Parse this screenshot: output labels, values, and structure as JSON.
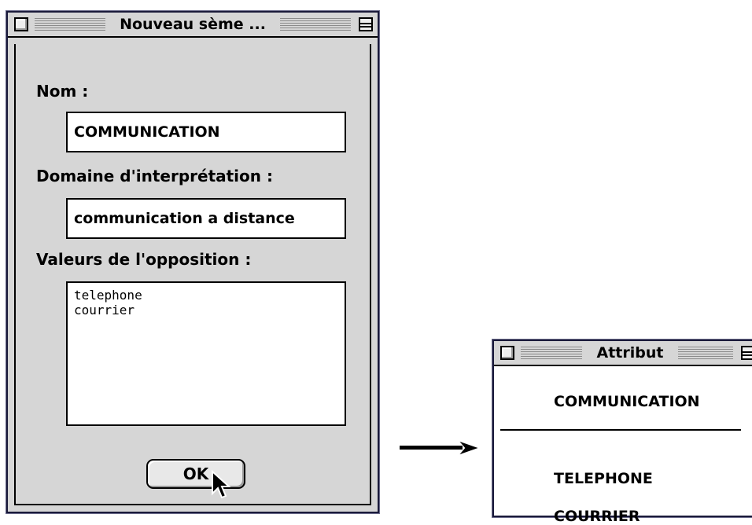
{
  "main_window": {
    "title": "Nouveau sème ...",
    "nom_label": "Nom :",
    "nom_value": "COMMUNICATION",
    "domaine_label": "Domaine d'interprétation :",
    "domaine_value": "communication a distance",
    "valeurs_label": "Valeurs de l'opposition :",
    "valeurs_lines": [
      "telephone",
      "courrier"
    ],
    "ok_label": "OK"
  },
  "attribut_window": {
    "title": "Attribut",
    "header": "COMMUNICATION",
    "values": [
      "TELEPHONE",
      "COURRIER"
    ]
  },
  "icons": {
    "close": "close-box-icon",
    "zoom": "zoom-box-icon",
    "cursor": "arrow-cursor-icon",
    "arrow": "right-arrow-icon"
  }
}
